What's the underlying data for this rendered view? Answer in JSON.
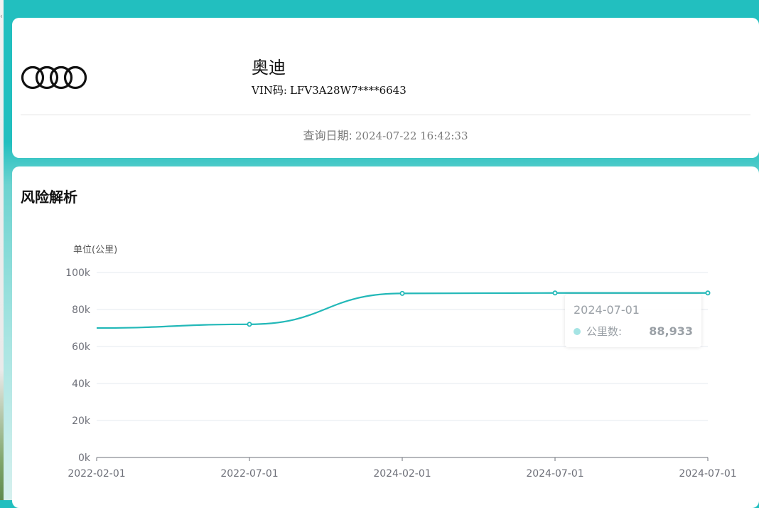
{
  "header": {
    "brand": "奥迪",
    "vin_label": "VIN码:",
    "vin_value": "LFV3A28W7****6643",
    "query_label": "查询日期:",
    "query_value": "2024-07-22 16:42:33",
    "logo_icon": "audi-rings-icon"
  },
  "risk": {
    "title": "风险解析"
  },
  "colors": {
    "header_bg": "#22bfbf",
    "line": "#22b8b8",
    "tooltip_dot": "#a5e4e4"
  },
  "tooltip": {
    "date": "2024-07-01",
    "series_name": "公里数:",
    "value": "88,933"
  },
  "chart_data": {
    "type": "line",
    "unit_label": "单位(公里)",
    "categories": [
      "2022-02-01",
      "2022-07-01",
      "2024-02-01",
      "2024-07-01",
      "2024-07-01"
    ],
    "series": [
      {
        "name": "公里数",
        "values": [
          70000,
          72000,
          88700,
          88933,
          88933
        ]
      }
    ],
    "ylim": [
      0,
      100000
    ],
    "yticks": [
      0,
      20000,
      40000,
      60000,
      80000,
      100000
    ],
    "ytick_labels": [
      "0k",
      "20k",
      "40k",
      "60k",
      "80k",
      "100k"
    ],
    "grid": true,
    "smooth": true
  }
}
